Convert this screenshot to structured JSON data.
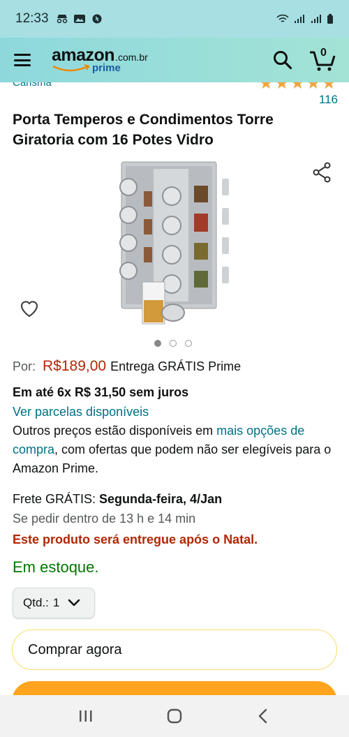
{
  "status_bar": {
    "time": "12:33"
  },
  "header": {
    "logo_text": "amazon",
    "logo_domain": ".com.br",
    "logo_prime": "prime",
    "cart_count": "0"
  },
  "product": {
    "brand_partial": "Carisma",
    "rating_stars": 4.5,
    "review_count": "116",
    "title": "Porta Temperos e Condimentos Torre Giratoria com 16 Potes Vidro",
    "image_count": 3,
    "active_image_index": 0
  },
  "pricing": {
    "price_label": "Por:",
    "price": "R$189,00",
    "delivery_prime": "Entrega GRÁTIS Prime",
    "installments": "Em até 6x R$ 31,50 sem juros",
    "see_installments": "Ver parcelas disponíveis",
    "other_prices_pre": "Outros preços estão disponíveis em ",
    "other_prices_link": "mais opções de compra",
    "other_prices_post": ", com ofertas que podem não ser elegíveis para o Amazon Prime."
  },
  "delivery": {
    "frete_label": "Frete GRÁTIS: ",
    "frete_date": "Segunda-feira, 4/Jan",
    "order_within": "Se pedir dentro de 13 h e 14 min",
    "after_christmas": "Este produto será entregue após o Natal.",
    "stock": "Em estoque."
  },
  "purchase": {
    "qty_label": "Qtd.:",
    "qty_value": "1",
    "buy_now": "Comprar agora"
  },
  "colors": {
    "header_bg": "#a8dfe3",
    "link": "#007185",
    "price": "#b12704",
    "stock": "#007600",
    "star": "#f2a33c",
    "add_to_cart": "#ffa41c"
  }
}
